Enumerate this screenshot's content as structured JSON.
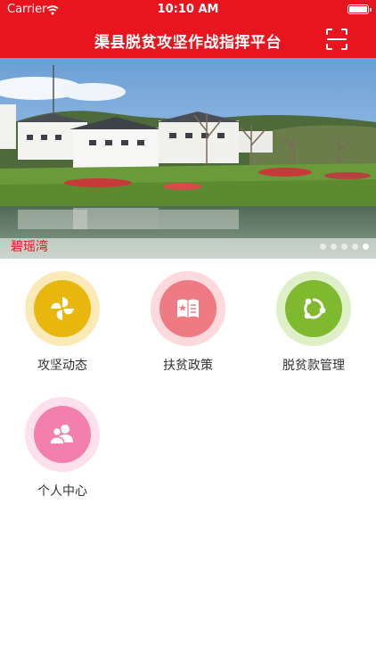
{
  "status_bar": {
    "carrier": "Carrier",
    "time": "10:10 AM"
  },
  "header": {
    "title": "渠县脱贫攻坚作战指挥平台"
  },
  "banner": {
    "caption": "碧瑶湾",
    "slide_count": 5,
    "active_index": 4
  },
  "grid": {
    "items": [
      {
        "label": "攻坚动态",
        "icon": "pinwheel-icon",
        "ring": "#fbeab8",
        "color": "#e9b80e"
      },
      {
        "label": "扶贫政策",
        "icon": "policy-book-icon",
        "ring": "#fbd9dc",
        "color": "#ee7a84"
      },
      {
        "label": "脱贫款管理",
        "icon": "fund-cycle-icon",
        "ring": "#dff0c8",
        "color": "#7fb92d"
      },
      {
        "label": "个人中心",
        "icon": "users-icon",
        "ring": "#fde0ec",
        "color": "#f37fad"
      }
    ]
  },
  "colors": {
    "brand": "#e8141e"
  }
}
